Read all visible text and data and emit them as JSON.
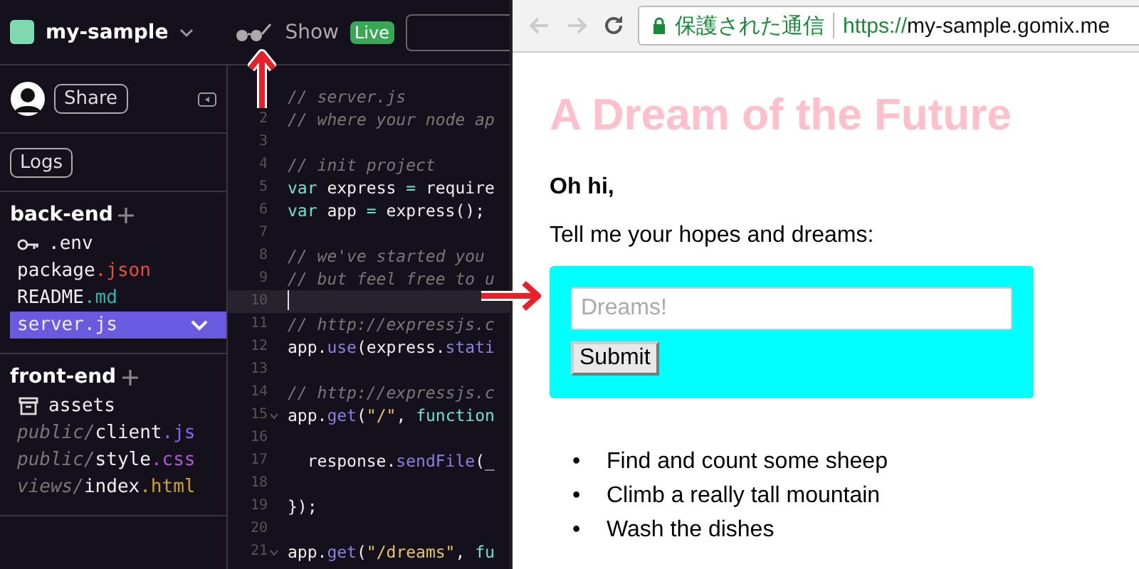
{
  "header": {
    "project": "my-sample",
    "show": "Show",
    "live": "Live"
  },
  "sidebar": {
    "share": "Share",
    "logs": "Logs",
    "sections": [
      {
        "title": "back-end",
        "files": [
          {
            "kind": "env",
            "name": ".env",
            "selected": false
          },
          {
            "kind": "file",
            "name": "package",
            "ext": ".json",
            "color": "#e0503c",
            "selected": false
          },
          {
            "kind": "file",
            "name": "README",
            "ext": ".md",
            "color": "#2fb5a5",
            "selected": false
          },
          {
            "kind": "file",
            "name": "server",
            "ext": ".js",
            "selected": true
          }
        ]
      },
      {
        "title": "front-end",
        "files": [
          {
            "kind": "folder",
            "name": "assets",
            "selected": false
          },
          {
            "kind": "file",
            "dir": "public/",
            "name": "client",
            "ext": ".js",
            "color": "#7d6af0",
            "selected": false
          },
          {
            "kind": "file",
            "dir": "public/",
            "name": "style",
            "ext": ".css",
            "color": "#a85bc9",
            "selected": false
          },
          {
            "kind": "file",
            "dir": "views/",
            "name": "index",
            "ext": ".html",
            "color": "#c9a32a",
            "selected": false
          }
        ]
      }
    ]
  },
  "editor": {
    "lines": [
      {
        "current": false,
        "tokens": [
          {
            "kind": "comment",
            "text": "// server.js"
          }
        ]
      },
      {
        "number": "2",
        "current": false,
        "tokens": [
          {
            "kind": "comment",
            "text": "// where your node ap"
          }
        ]
      },
      {
        "number": "3",
        "current": false
      },
      {
        "number": "4",
        "current": false,
        "tokens": [
          {
            "kind": "comment",
            "text": "// init project"
          }
        ]
      },
      {
        "number": "5",
        "current": false,
        "tokens": [
          {
            "kind": "keyword",
            "text": "var"
          },
          {
            "kind": "plain",
            "text": " express "
          },
          {
            "kind": "keyword",
            "text": "="
          },
          {
            "kind": "plain",
            "text": " require"
          }
        ]
      },
      {
        "number": "6",
        "current": false,
        "tokens": [
          {
            "kind": "keyword",
            "text": "var"
          },
          {
            "kind": "plain",
            "text": " app "
          },
          {
            "kind": "keyword",
            "text": "="
          },
          {
            "kind": "plain",
            "text": " express();"
          }
        ]
      },
      {
        "number": "7",
        "current": false
      },
      {
        "number": "8",
        "current": false,
        "tokens": [
          {
            "kind": "comment",
            "text": "// we've started you"
          }
        ]
      },
      {
        "number": "9",
        "current": false,
        "tokens": [
          {
            "kind": "comment",
            "text": "// but feel free to u"
          }
        ]
      },
      {
        "number": "10",
        "current": true
      },
      {
        "number": "11",
        "current": false,
        "tokens": [
          {
            "kind": "comment",
            "text": "// http://expressjs.c"
          }
        ]
      },
      {
        "number": "12",
        "current": false,
        "tokens": [
          {
            "kind": "plain",
            "text": "app."
          },
          {
            "kind": "method",
            "text": "use"
          },
          {
            "kind": "plain",
            "text": "(express."
          },
          {
            "kind": "method",
            "text": "stati"
          }
        ]
      },
      {
        "number": "13",
        "current": false
      },
      {
        "number": "14",
        "current": false,
        "tokens": [
          {
            "kind": "comment",
            "text": "// http://expressjs.c"
          }
        ]
      },
      {
        "number": "15",
        "fold": true,
        "current": false,
        "tokens": [
          {
            "kind": "plain",
            "text": "app."
          },
          {
            "kind": "method",
            "text": "get"
          },
          {
            "kind": "plain",
            "text": "("
          },
          {
            "kind": "string",
            "text": "\"/\""
          },
          {
            "kind": "plain",
            "text": ", "
          },
          {
            "kind": "keyword",
            "text": "function"
          }
        ]
      },
      {
        "number": "16",
        "current": false
      },
      {
        "number": "17",
        "current": false,
        "tokens": [
          {
            "kind": "plain",
            "text": "  response."
          },
          {
            "kind": "method",
            "text": "sendFile"
          },
          {
            "kind": "plain",
            "text": "(_"
          }
        ]
      },
      {
        "number": "18",
        "current": false
      },
      {
        "number": "19",
        "current": false,
        "tokens": [
          {
            "kind": "plain",
            "text": "});"
          }
        ]
      },
      {
        "number": "20",
        "current": false
      },
      {
        "number": "21",
        "fold": true,
        "current": false,
        "tokens": [
          {
            "kind": "plain",
            "text": "app."
          },
          {
            "kind": "method",
            "text": "get"
          },
          {
            "kind": "plain",
            "text": "("
          },
          {
            "kind": "string",
            "text": "\"/dreams\""
          },
          {
            "kind": "plain",
            "text": ", "
          },
          {
            "kind": "keyword",
            "text": "fu"
          }
        ]
      }
    ]
  },
  "browser": {
    "security": "保護された通信",
    "scheme": "https://",
    "host": "my-sample.gomix.me",
    "page": {
      "title": "A Dream of the Future",
      "greeting": "Oh hi,",
      "prompt": "Tell me your hopes and dreams:",
      "input": {
        "placeholder": "Dreams!"
      },
      "submit": "Submit",
      "dreams": [
        {
          "bullet": "•",
          "text": "Find and count some sheep"
        },
        {
          "bullet": "•",
          "text": "Climb a really tall mountain"
        },
        {
          "bullet": "•",
          "text": "Wash the dishes"
        }
      ]
    }
  }
}
